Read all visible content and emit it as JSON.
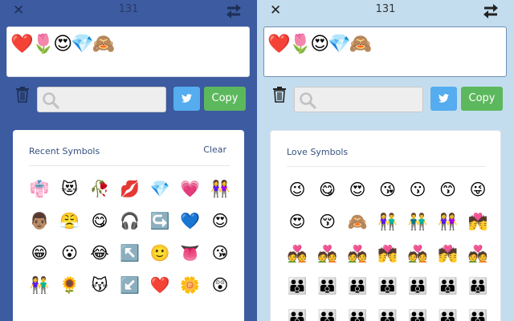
{
  "left_panel": {
    "count": "131",
    "text_value": "❤️🌷😍💎🙈",
    "copy_label": "Copy",
    "section_title": "Recent Symbols",
    "clear_label": "Clear",
    "emojis": [
      [
        "👘",
        "😻",
        "🥀",
        "💋",
        "💎",
        "💗",
        "👭"
      ],
      [
        "👨🏽",
        "😤",
        "😋",
        "🎧",
        "↪️",
        "💙",
        "😍"
      ],
      [
        "😁",
        "😮",
        "😂",
        "↖️",
        "🙂",
        "👅",
        "😘"
      ],
      [
        "👫",
        "🌻",
        "😽",
        "↙️",
        "❤️",
        "🌼",
        "😲"
      ]
    ]
  },
  "right_panel": {
    "count": "131",
    "text_value": "❤️🌷😍💎🙈",
    "copy_label": "Copy",
    "section_title": "Love Symbols",
    "emojis": [
      [
        "😉",
        "😋",
        "😍",
        "😘",
        "😗",
        "😙",
        "😜"
      ],
      [
        "😍",
        "😚",
        "🙈",
        "👫",
        "👬",
        "👭",
        "💏"
      ],
      [
        "💑",
        "💑",
        "💑",
        "💏",
        "💑",
        "💏",
        "💑"
      ],
      [
        "👪",
        "👪",
        "👪",
        "👪",
        "👪",
        "👪",
        "👪"
      ],
      [
        "👪",
        "👪",
        "👪",
        "👪",
        "👪",
        "👪",
        "👪"
      ]
    ]
  },
  "colors": {
    "left_background": "#3c5ba0",
    "right_background": "#c3ddef",
    "twitter_blue": "#55acee",
    "copy_green": "#5cb85c"
  }
}
